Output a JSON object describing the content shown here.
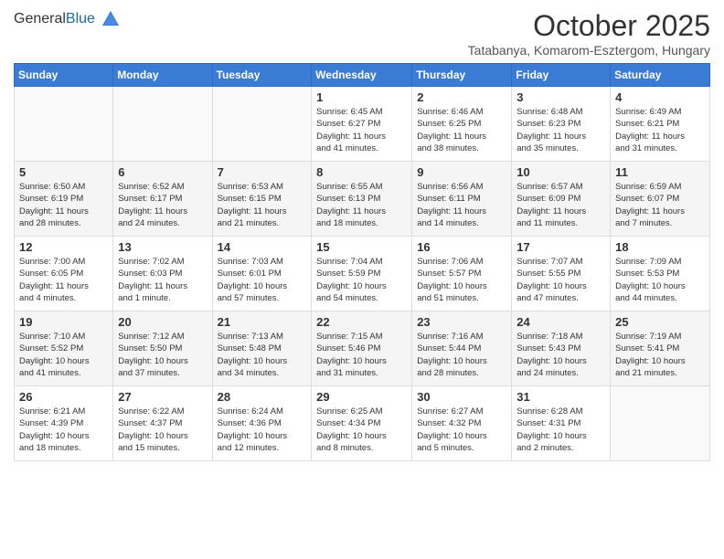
{
  "header": {
    "logo_general": "General",
    "logo_blue": "Blue",
    "month": "October 2025",
    "location": "Tatabanya, Komarom-Esztergom, Hungary"
  },
  "columns": [
    "Sunday",
    "Monday",
    "Tuesday",
    "Wednesday",
    "Thursday",
    "Friday",
    "Saturday"
  ],
  "weeks": [
    [
      {
        "day": "",
        "info": ""
      },
      {
        "day": "",
        "info": ""
      },
      {
        "day": "",
        "info": ""
      },
      {
        "day": "1",
        "info": "Sunrise: 6:45 AM\nSunset: 6:27 PM\nDaylight: 11 hours\nand 41 minutes."
      },
      {
        "day": "2",
        "info": "Sunrise: 6:46 AM\nSunset: 6:25 PM\nDaylight: 11 hours\nand 38 minutes."
      },
      {
        "day": "3",
        "info": "Sunrise: 6:48 AM\nSunset: 6:23 PM\nDaylight: 11 hours\nand 35 minutes."
      },
      {
        "day": "4",
        "info": "Sunrise: 6:49 AM\nSunset: 6:21 PM\nDaylight: 11 hours\nand 31 minutes."
      }
    ],
    [
      {
        "day": "5",
        "info": "Sunrise: 6:50 AM\nSunset: 6:19 PM\nDaylight: 11 hours\nand 28 minutes."
      },
      {
        "day": "6",
        "info": "Sunrise: 6:52 AM\nSunset: 6:17 PM\nDaylight: 11 hours\nand 24 minutes."
      },
      {
        "day": "7",
        "info": "Sunrise: 6:53 AM\nSunset: 6:15 PM\nDaylight: 11 hours\nand 21 minutes."
      },
      {
        "day": "8",
        "info": "Sunrise: 6:55 AM\nSunset: 6:13 PM\nDaylight: 11 hours\nand 18 minutes."
      },
      {
        "day": "9",
        "info": "Sunrise: 6:56 AM\nSunset: 6:11 PM\nDaylight: 11 hours\nand 14 minutes."
      },
      {
        "day": "10",
        "info": "Sunrise: 6:57 AM\nSunset: 6:09 PM\nDaylight: 11 hours\nand 11 minutes."
      },
      {
        "day": "11",
        "info": "Sunrise: 6:59 AM\nSunset: 6:07 PM\nDaylight: 11 hours\nand 7 minutes."
      }
    ],
    [
      {
        "day": "12",
        "info": "Sunrise: 7:00 AM\nSunset: 6:05 PM\nDaylight: 11 hours\nand 4 minutes."
      },
      {
        "day": "13",
        "info": "Sunrise: 7:02 AM\nSunset: 6:03 PM\nDaylight: 11 hours\nand 1 minute."
      },
      {
        "day": "14",
        "info": "Sunrise: 7:03 AM\nSunset: 6:01 PM\nDaylight: 10 hours\nand 57 minutes."
      },
      {
        "day": "15",
        "info": "Sunrise: 7:04 AM\nSunset: 5:59 PM\nDaylight: 10 hours\nand 54 minutes."
      },
      {
        "day": "16",
        "info": "Sunrise: 7:06 AM\nSunset: 5:57 PM\nDaylight: 10 hours\nand 51 minutes."
      },
      {
        "day": "17",
        "info": "Sunrise: 7:07 AM\nSunset: 5:55 PM\nDaylight: 10 hours\nand 47 minutes."
      },
      {
        "day": "18",
        "info": "Sunrise: 7:09 AM\nSunset: 5:53 PM\nDaylight: 10 hours\nand 44 minutes."
      }
    ],
    [
      {
        "day": "19",
        "info": "Sunrise: 7:10 AM\nSunset: 5:52 PM\nDaylight: 10 hours\nand 41 minutes."
      },
      {
        "day": "20",
        "info": "Sunrise: 7:12 AM\nSunset: 5:50 PM\nDaylight: 10 hours\nand 37 minutes."
      },
      {
        "day": "21",
        "info": "Sunrise: 7:13 AM\nSunset: 5:48 PM\nDaylight: 10 hours\nand 34 minutes."
      },
      {
        "day": "22",
        "info": "Sunrise: 7:15 AM\nSunset: 5:46 PM\nDaylight: 10 hours\nand 31 minutes."
      },
      {
        "day": "23",
        "info": "Sunrise: 7:16 AM\nSunset: 5:44 PM\nDaylight: 10 hours\nand 28 minutes."
      },
      {
        "day": "24",
        "info": "Sunrise: 7:18 AM\nSunset: 5:43 PM\nDaylight: 10 hours\nand 24 minutes."
      },
      {
        "day": "25",
        "info": "Sunrise: 7:19 AM\nSunset: 5:41 PM\nDaylight: 10 hours\nand 21 minutes."
      }
    ],
    [
      {
        "day": "26",
        "info": "Sunrise: 6:21 AM\nSunset: 4:39 PM\nDaylight: 10 hours\nand 18 minutes."
      },
      {
        "day": "27",
        "info": "Sunrise: 6:22 AM\nSunset: 4:37 PM\nDaylight: 10 hours\nand 15 minutes."
      },
      {
        "day": "28",
        "info": "Sunrise: 6:24 AM\nSunset: 4:36 PM\nDaylight: 10 hours\nand 12 minutes."
      },
      {
        "day": "29",
        "info": "Sunrise: 6:25 AM\nSunset: 4:34 PM\nDaylight: 10 hours\nand 8 minutes."
      },
      {
        "day": "30",
        "info": "Sunrise: 6:27 AM\nSunset: 4:32 PM\nDaylight: 10 hours\nand 5 minutes."
      },
      {
        "day": "31",
        "info": "Sunrise: 6:28 AM\nSunset: 4:31 PM\nDaylight: 10 hours\nand 2 minutes."
      },
      {
        "day": "",
        "info": ""
      }
    ]
  ]
}
